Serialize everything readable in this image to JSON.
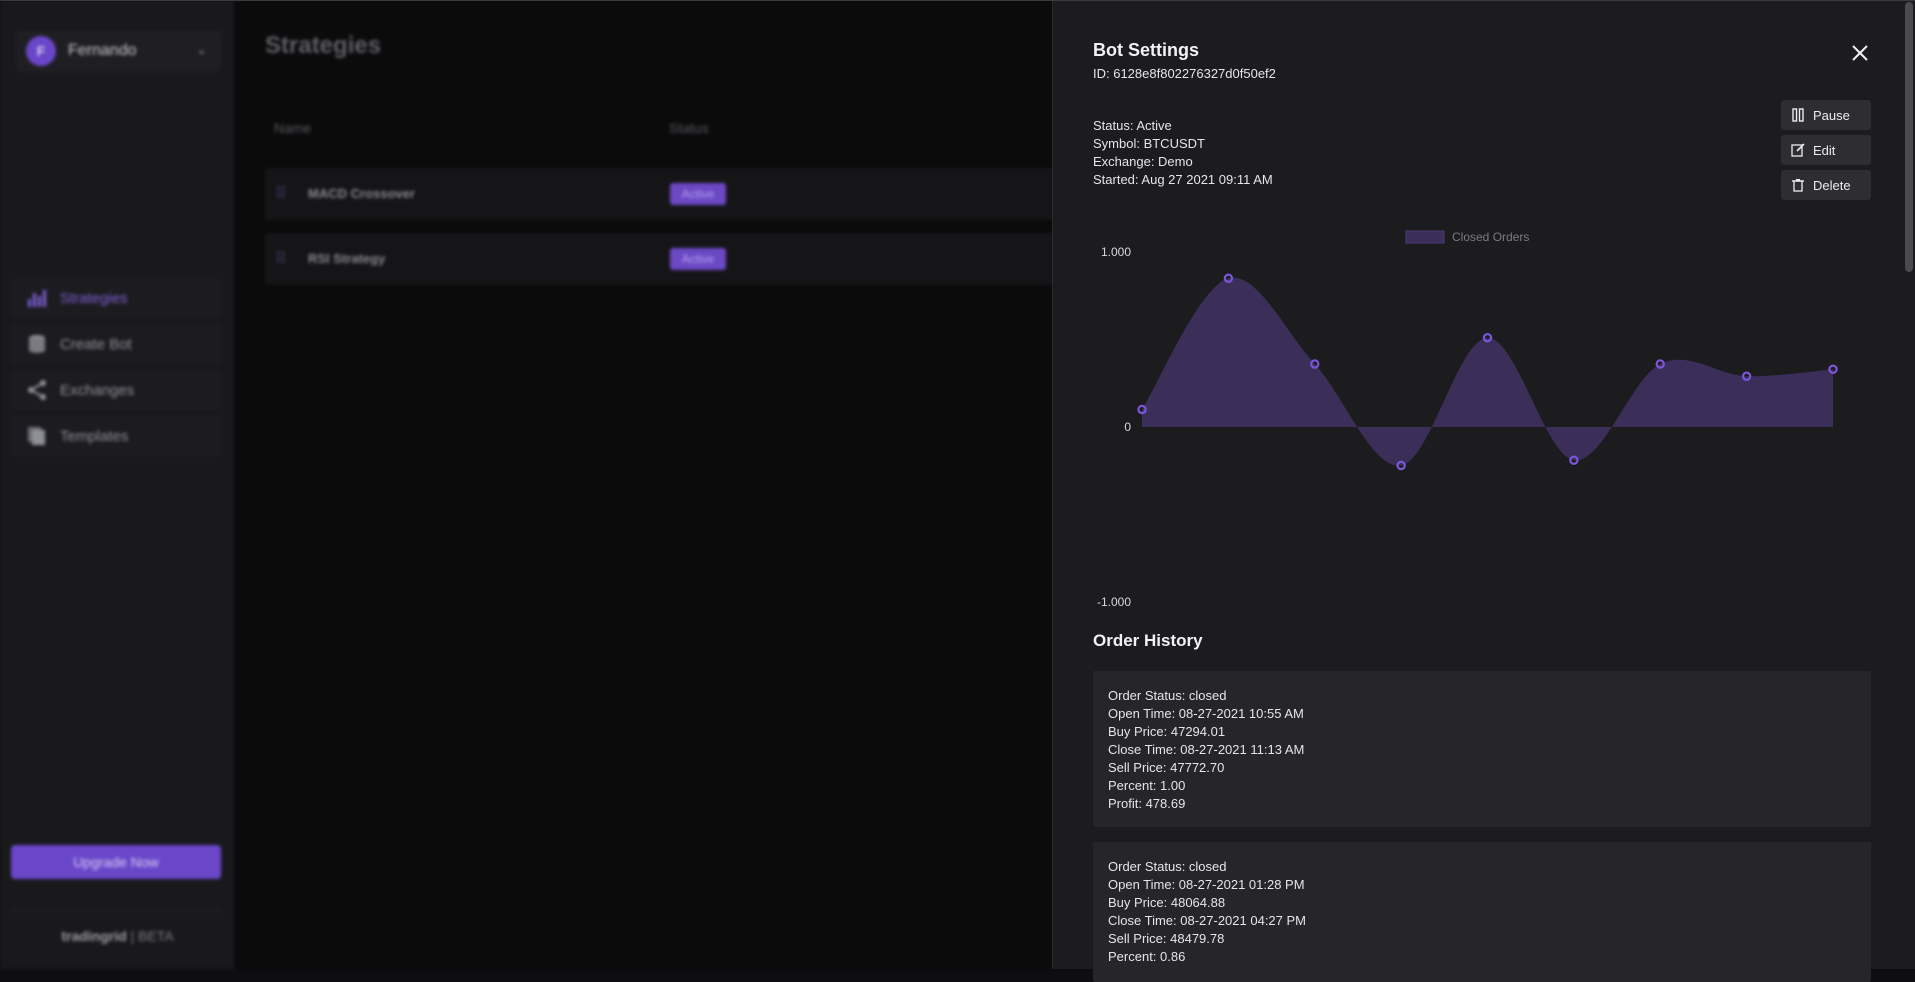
{
  "user": {
    "initial": "F",
    "name": "Fernando"
  },
  "nav": {
    "items": [
      {
        "label": "Strategies",
        "icon": "bar-chart-icon",
        "active": true
      },
      {
        "label": "Create Bot",
        "icon": "database-icon",
        "active": false
      },
      {
        "label": "Exchanges",
        "icon": "share-icon",
        "active": false
      },
      {
        "label": "Templates",
        "icon": "copy-icon",
        "active": false
      }
    ]
  },
  "upgrade_label": "Upgrade Now",
  "brand": {
    "name": "tradingrid",
    "suffix": " | BETA"
  },
  "main": {
    "title": "Strategies",
    "columns": [
      "Name",
      "Status"
    ],
    "rows": [
      {
        "name": "MACD Crossover",
        "status": "Active"
      },
      {
        "name": "RSI Strategy",
        "status": "Active"
      }
    ]
  },
  "drawer": {
    "title": "Bot Settings",
    "id_text": "ID: 6128e8f802276327d0f50ef2",
    "info": {
      "status": "Status: Active",
      "symbol": "Symbol: BTCUSDT",
      "exchange": "Exchange: Demo",
      "started": "Started: Aug 27 2021 09:11 AM"
    },
    "actions": {
      "pause": "Pause",
      "edit": "Edit",
      "delete": "Delete"
    },
    "order_history_title": "Order History",
    "orders": [
      {
        "status": "Order Status: closed",
        "open_time": "Open Time: 08-27-2021 10:55 AM",
        "buy_price": "Buy Price: 47294.01",
        "close_time": "Close Time: 08-27-2021 11:13 AM",
        "sell_price": "Sell Price: 47772.70",
        "percent": "Percent: 1.00",
        "profit": "Profit: 478.69"
      },
      {
        "status": "Order Status: closed",
        "open_time": "Open Time: 08-27-2021 01:28 PM",
        "buy_price": "Buy Price: 48064.88",
        "close_time": "Close Time: 08-27-2021 04:27 PM",
        "sell_price": "Sell Price: 48479.78",
        "percent": "Percent: 0.86",
        "profit": ""
      }
    ]
  },
  "colors": {
    "accent": "#6a46c9",
    "area": "#3b2f5a",
    "point": "#7b55d8"
  },
  "chart_data": {
    "type": "area",
    "series": [
      {
        "name": "Closed Orders",
        "values": [
          0.1,
          0.85,
          0.36,
          -0.22,
          0.51,
          -0.19,
          0.36,
          0.29,
          0.33
        ]
      }
    ],
    "yticks": [
      "1.000",
      "0",
      "-1.000"
    ],
    "ylim": [
      -1,
      1
    ],
    "legend": "top-center",
    "grid": false
  }
}
